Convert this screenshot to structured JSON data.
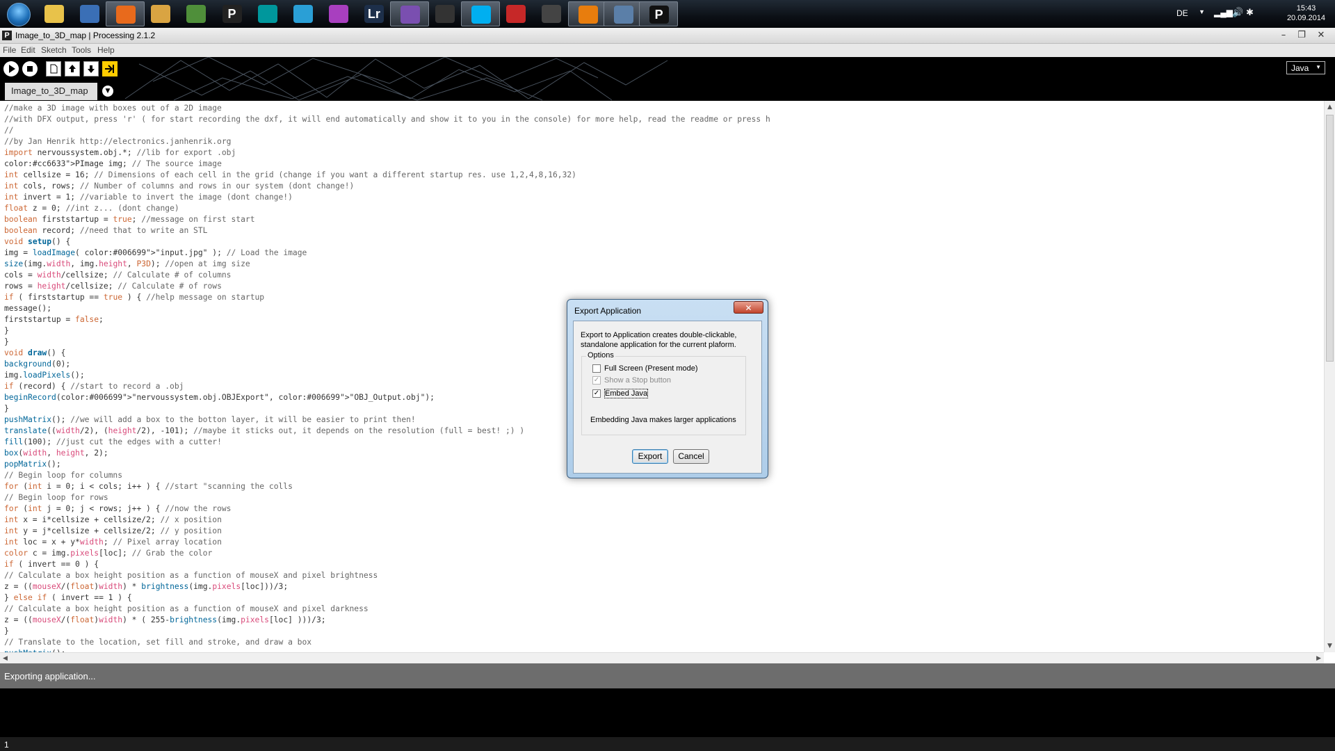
{
  "taskbar": {
    "apps": [
      {
        "name": "folder"
      },
      {
        "name": "thunderbird"
      },
      {
        "name": "firefox",
        "active": true
      },
      {
        "name": "photo-viewer"
      },
      {
        "name": "minecraft"
      },
      {
        "name": "processing-alt",
        "glyph": "P"
      },
      {
        "name": "arduino"
      },
      {
        "name": "fritzing"
      },
      {
        "name": "inkscape-like"
      },
      {
        "name": "lightroom",
        "glyph": "Lr"
      },
      {
        "name": "pidgin",
        "active": true
      },
      {
        "name": "steam"
      },
      {
        "name": "skype",
        "active": true
      },
      {
        "name": "red-app"
      },
      {
        "name": "inkscape"
      },
      {
        "name": "blender",
        "active": true
      },
      {
        "name": "image-app",
        "active": true
      },
      {
        "name": "processing",
        "glyph": "P",
        "active": true
      }
    ],
    "language": "DE",
    "time": "15:43",
    "date": "20.09.2014"
  },
  "window": {
    "title": "Image_to_3D_map | Processing 2.1.2",
    "menu": [
      "File",
      "Edit",
      "Sketch",
      "Tools",
      "Help"
    ],
    "mode": "Java",
    "tab": "Image_to_3D_map"
  },
  "code_lines": [
    "//make a 3D image with boxes out of a 2D image",
    "//with DFX output, press 'r' ( for start recording the dxf, it will end automatically and show it to you in the console) for more help, read the readme or press h",
    "//",
    "//by Jan Henrik http://electronics.janhenrik.org",
    "import nervoussystem.obj.*; //lib for export .obj",
    "PImage img; // The source image",
    "int cellsize = 16; // Dimensions of each cell in the grid (change if you want a different startup res. use 1,2,4,8,16,32)",
    "int cols, rows; // Number of columns and rows in our system (dont change!)",
    "int invert = 1; //variable to invert the image (dont change!)",
    "float z = 0; //int z... (dont change)",
    "boolean firststartup = true; //message on first start",
    "boolean record; //need that to write an STL",
    "void setup() {",
    "img = loadImage( \"input.jpg\" ); // Load the image",
    "size(img.width, img.height, P3D); //open at img size",
    "cols = width/cellsize; // Calculate # of columns",
    "rows = height/cellsize; // Calculate # of rows",
    "if ( firststartup == true ) { //help message on startup",
    "message();",
    "firststartup = false;",
    "}",
    "}",
    "void draw() {",
    "background(0);",
    "img.loadPixels();",
    "if (record) { //start to record a .obj",
    "beginRecord(\"nervoussystem.obj.OBJExport\", \"OBJ_Output.obj\");",
    "}",
    "pushMatrix(); //we will add a box to the botton layer, it will be easier to print then!",
    "translate((width/2), (height/2), -101); //maybe it sticks out, it depends on the resolution (full = best! ;) )",
    "fill(100); //just cut the edges with a cutter!",
    "box(width, height, 2);",
    "popMatrix();",
    "// Begin loop for columns",
    "for (int i = 0; i < cols; i++ ) { //start \"scanning the colls",
    "// Begin loop for rows",
    "for (int j = 0; j < rows; j++ ) { //now the rows",
    "int x = i*cellsize + cellsize/2; // x position",
    "int y = j*cellsize + cellsize/2; // y position",
    "int loc = x + y*width; // Pixel array location",
    "color c = img.pixels[loc]; // Grab the color",
    "if ( invert == 0 ) {",
    "// Calculate a box height position as a function of mouseX and pixel brightness",
    "z = ((mouseX/(float)width) * brightness(img.pixels[loc]))/3;",
    "} else if ( invert == 1 ) {",
    "// Calculate a box height position as a function of mouseX and pixel darkness",
    "z = ((mouseX/(float)width) * ( 255-brightness(img.pixels[loc] )))/3;",
    "}",
    "// Translate to the location, set fill and stroke, and draw a box",
    "pushMatrix();"
  ],
  "status": "Exporting application...",
  "line_number": "1",
  "dialog": {
    "title": "Export Application",
    "close": "✕",
    "message": "Export to Application creates double-clickable, standalone application for the current plaform.",
    "options_legend": "Options",
    "full_screen": "Full Screen (Present mode)",
    "stop_button": "Show a Stop button",
    "embed_java": "Embed Java",
    "embed_note": "Embedding Java makes larger applications",
    "export": "Export",
    "cancel": "Cancel"
  },
  "colors": {
    "keyword": "#cc6633",
    "comment": "#666666",
    "string": "#006699",
    "function": "#006699",
    "builtin": "#d94a7a",
    "literal": "#cc6633"
  }
}
